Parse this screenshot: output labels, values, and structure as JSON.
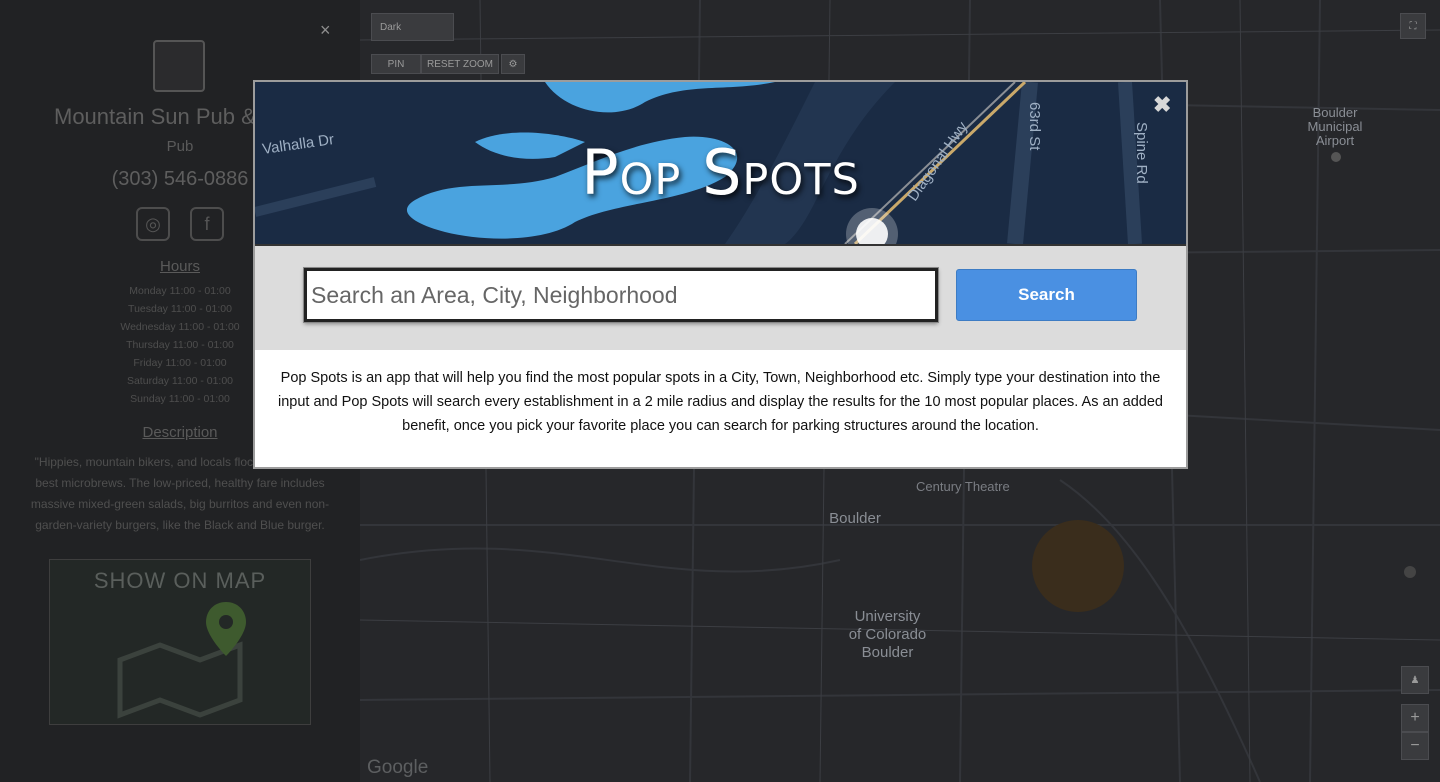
{
  "sidebar": {
    "close_icon": "×",
    "place_name": "Mountain Sun Pub & Br",
    "place_type": "Pub",
    "phone": "(303) 546-0886",
    "website_icon": "globe-icon",
    "facebook_icon": "facebook-icon",
    "facebook_glyph": "f",
    "hours_heading": "Hours",
    "hours": [
      "Monday 11:00 - 01:00",
      "Tuesday 11:00 - 01:00",
      "Wednesday 11:00 - 01:00",
      "Thursday 11:00 - 01:00",
      "Friday 11:00 - 01:00",
      "Saturday 11:00 - 01:00",
      "Sunday 11:00 - 01:00"
    ],
    "description_heading": "Description",
    "description": "\"Hippies, mountain bikers, and locals flock to Boulder's best microbrews. The low-priced, healthy fare includes massive mixed-green salads, big burritos and even non-garden-variety burgers, like the Black and Blue burger.",
    "show_on_map_label": "SHOW ON MAP"
  },
  "map": {
    "style_select": "Dark",
    "controls": [
      "PIN",
      "RESET ZOOM"
    ],
    "labels": {
      "airport": "Boulder\nMunicipal\nAirport",
      "university": "University\nof Colorado\nBoulder",
      "boulder": "Boulder",
      "theatre": "Century Theatre"
    },
    "zoom_in": "+",
    "zoom_out": "−",
    "attribution": "Google",
    "colors": {
      "map_bg": "#26272a",
      "road": "#3a3b3f"
    }
  },
  "modal": {
    "title": "Pop Spots",
    "close_icon": "✖",
    "search": {
      "placeholder": "Search an Area, City, Neighborhood",
      "value": "",
      "button_label": "Search"
    },
    "about": "Pop Spots is an app that will help you find the most popular spots in a City, Town, Neighborhood etc. Simply type your destination into the input and Pop Spots will search every establishment in a 2 mile radius and display the results for the 10 most popular places. As an added benefit, once you pick your favorite place you can search for parking structures around the location.",
    "banner_streets": [
      "Valhalla Dr",
      "Diagonal Hwy",
      "63rd St",
      "Spine Rd"
    ],
    "colors": {
      "banner": "#16253b",
      "water": "#4aa3df",
      "button": "#4a90e2",
      "band": "#dcdcdc"
    }
  }
}
